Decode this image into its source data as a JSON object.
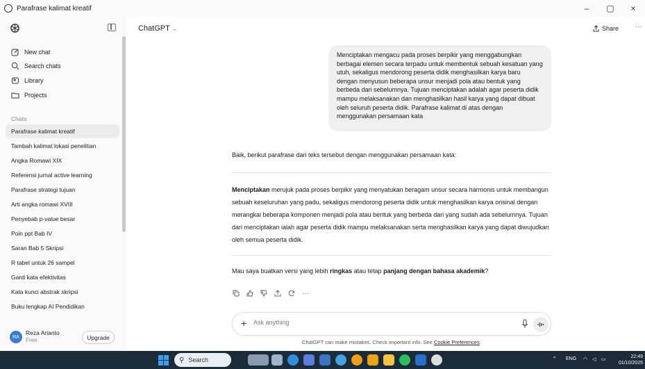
{
  "window": {
    "title": "Parafrase kalimat kreatif",
    "controls": [
      "–",
      "▢",
      "×"
    ]
  },
  "sidebar": {
    "nav": [
      {
        "label": "New chat",
        "icon": "pencil-square-icon"
      },
      {
        "label": "Search chats",
        "icon": "search-icon"
      },
      {
        "label": "Library",
        "icon": "library-icon"
      },
      {
        "label": "Projects",
        "icon": "folder-icon"
      }
    ],
    "section_label": "Chats",
    "chats": [
      "Parafrase kalimat kreatif",
      "Tambah kalimat lokasi penelitian",
      "Angka Romawi XIX",
      "Referensi jurnal active learning",
      "Parafrase strategi tujuan",
      "Arti angka romawi XVIII",
      "Penyebab p-value besar",
      "Poin ppt Bab IV",
      "Saran Bab 5 Skripsi",
      "R tabel untuk 26 sampel",
      "Ganti kata efektivitas",
      "Kata kunci abstrak skripsi",
      "Buku lengkap AI Pendidikan"
    ],
    "active_index": 0,
    "user": {
      "initials": "RA",
      "name": "Reza Arianto",
      "plan": "Free",
      "upgrade_label": "Upgrade"
    }
  },
  "header": {
    "model": "ChatGPT",
    "model_chevron": "⌄",
    "share_label": "Share",
    "more": "···"
  },
  "conversation": {
    "user_message": "Menciptakan mengacu pada proses berpikir yang menggabungkan berbagai elemen secara terpadu untuk membentuk sebuah kesatuan yang utuh, sekaligus mendorong peserta didik menghasilkan karya baru dengan menyusun beberapa unsur menjadi pola atau bentuk yang berbeda dari sebelumnya. Tujuan menciptakan adalah agar peserta didik mampu melaksanakan dan menghasilkan hasil karya yang dapat dibuat oleh seluruh peserta didik. Parafrase kalimat di atas dengan menggunakan persamaan kata",
    "intro": "Baik, berikut parafrase dari teks tersebut dengan menggunakan persamaan kata:",
    "para_bold": "Menciptakan",
    "para_rest": " merujuk pada proses berpikir yang menyatukan beragam unsur secara harmonis untuk membangun sebuah keseluruhan yang padu, sekaligus mendorong peserta didik untuk menghasilkan karya orisinal dengan merangkai beberapa komponen menjadi pola atau bentuk yang berbeda dari yang sudah ada sebelumnya. Tujuan dari menciptakan ialah agar peserta didik mampu melaksanakan serta menghasilkan karya yang dapat diwujudkan oleh semua peserta didik.",
    "q_pre": "Mau saya buatkan versi yang lebih ",
    "q_b1": "ringkas",
    "q_mid": " atau tetap ",
    "q_b2": "panjang dengan bahasa akademik",
    "q_post": "?",
    "actions": [
      "copy-icon",
      "thumbs-up-icon",
      "thumbs-down-icon",
      "share-icon",
      "regenerate-icon",
      "more-icon"
    ]
  },
  "composer": {
    "placeholder": "Ask anything",
    "plus": "+"
  },
  "footer": {
    "text": "ChatGPT can make mistakes. Check important info. See ",
    "link": "Cookie Preferences",
    "end": "."
  },
  "taskbar": {
    "search": "Search",
    "tray_lang": "ENG",
    "tray_caret": "^",
    "time": "22:49",
    "date": "01/10/2025"
  }
}
